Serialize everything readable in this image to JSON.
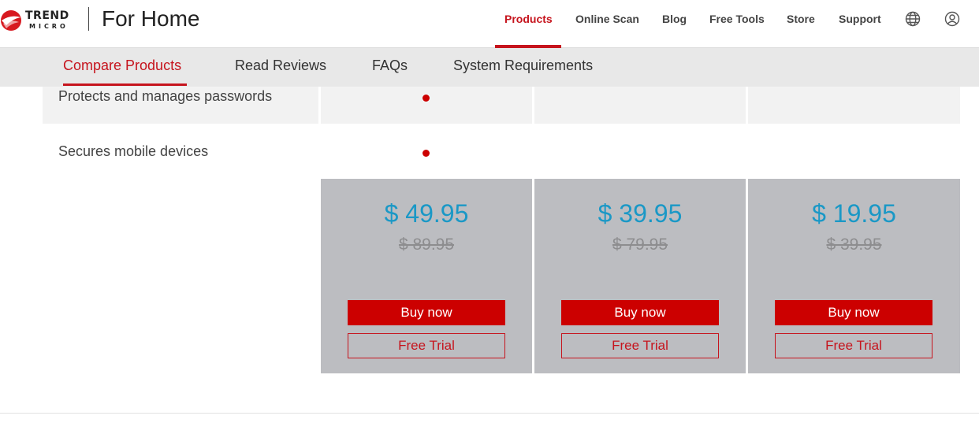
{
  "header": {
    "brand_line1": "TREND",
    "brand_line2": "MICRO",
    "site_title": "For Home",
    "nav": [
      "Products",
      "Online Scan",
      "Blog",
      "Free Tools",
      "Store",
      "Support"
    ],
    "active_nav": "Products",
    "icons": [
      "globe-icon",
      "user-icon"
    ]
  },
  "subnav": {
    "items": [
      "Compare Products",
      "Read Reviews",
      "FAQs",
      "System Requirements"
    ],
    "active": "Compare Products"
  },
  "features": [
    {
      "label": "Protects and manages passwords",
      "included": [
        true,
        false,
        false
      ]
    },
    {
      "label": "Secures mobile devices",
      "included": [
        true,
        false,
        false
      ]
    }
  ],
  "plans": [
    {
      "price": "$ 49.95",
      "old_price": "$ 89.95",
      "buy_label": "Buy now",
      "trial_label": "Free Trial"
    },
    {
      "price": "$ 39.95",
      "old_price": "$ 79.95",
      "buy_label": "Buy now",
      "trial_label": "Free Trial"
    },
    {
      "price": "$ 19.95",
      "old_price": "$ 39.95",
      "buy_label": "Buy now",
      "trial_label": "Free Trial"
    }
  ],
  "colors": {
    "accent": "#c6141d",
    "price": "#1a98c6",
    "card_bg": "#bcbdc1",
    "subnav_bg": "#e8e8e8"
  }
}
